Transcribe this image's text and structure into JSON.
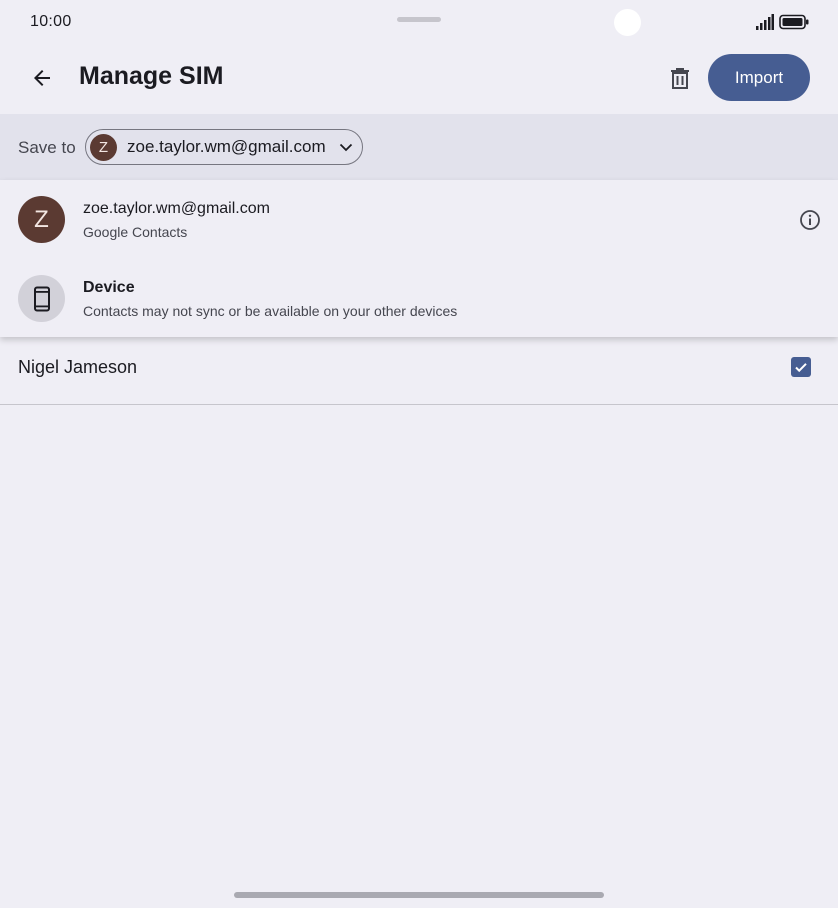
{
  "status_bar": {
    "time": "10:00"
  },
  "app_bar": {
    "title": "Manage SIM",
    "back_icon": "arrow-back-icon",
    "delete_icon": "trash-icon",
    "import_label": "Import"
  },
  "save_to": {
    "label": "Save to",
    "selected_account": {
      "initial": "Z",
      "email": "zoe.taylor.wm@gmail.com"
    }
  },
  "dropdown": {
    "items": [
      {
        "avatar_initial": "Z",
        "title": "zoe.taylor.wm@gmail.com",
        "subtitle": "Google Contacts",
        "trailing_icon": "info-icon"
      },
      {
        "icon": "phone-icon",
        "title": "Device",
        "subtitle": "Contacts may not sync or be available on your other devices"
      }
    ]
  },
  "contacts": [
    {
      "name": "Nigel Jameson",
      "checked": true
    }
  ],
  "colors": {
    "background": "#efeef5",
    "accent": "#465d92",
    "avatar": "#5b3a32",
    "save_bar": "#e2e2ec"
  }
}
